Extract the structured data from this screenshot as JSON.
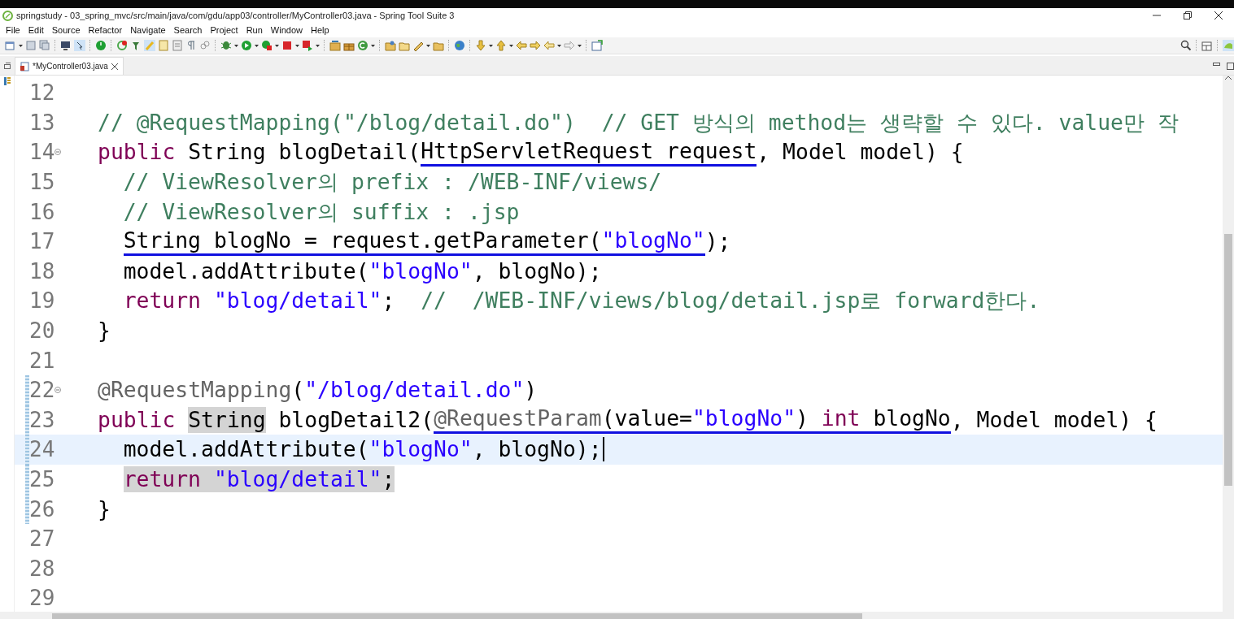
{
  "window": {
    "title": "springstudy - 03_spring_mvc/src/main/java/com/gdu/app03/controller/MyController03.java - Spring Tool Suite 3"
  },
  "menu": [
    "File",
    "Edit",
    "Source",
    "Refactor",
    "Navigate",
    "Search",
    "Project",
    "Run",
    "Window",
    "Help"
  ],
  "tabs": [
    {
      "label": "*MyController03.java",
      "selected": true
    }
  ],
  "editor": {
    "lines": [
      {
        "number": "12"
      },
      {
        "number": "13",
        "tokens": [
          {
            "kind": "comment",
            "text": "// @RequestMapping(\"/blog/detail.do\")  // GET 방식의 method는 생략할 수 있다. value만 작"
          }
        ]
      },
      {
        "number": "14",
        "fold": true,
        "tokens": [
          {
            "kind": "keyword",
            "text": "public"
          },
          {
            "kind": "plain",
            "text": " String blogDetail("
          },
          {
            "kind": "plain",
            "text": "HttpServletRequest request",
            "underline": true
          },
          {
            "kind": "plain",
            "text": ", Model model) {"
          }
        ]
      },
      {
        "number": "15",
        "indented": true,
        "tokens": [
          {
            "kind": "comment",
            "text": "// ViewResolver의 prefix : /WEB-INF/views/"
          }
        ]
      },
      {
        "number": "16",
        "indented": true,
        "tokens": [
          {
            "kind": "comment",
            "text": "// ViewResolver의 suffix : .jsp"
          }
        ]
      },
      {
        "number": "17",
        "indented": true,
        "tokens": [
          {
            "kind": "plain",
            "text": "String blogNo = request.getParameter(",
            "underline": true
          },
          {
            "kind": "string",
            "text": "\"blogNo\"",
            "underline": true
          },
          {
            "kind": "plain",
            "text": ");"
          }
        ]
      },
      {
        "number": "18",
        "indented": true,
        "tokens": [
          {
            "kind": "plain",
            "text": "model.addAttribute("
          },
          {
            "kind": "string",
            "text": "\"blogNo\""
          },
          {
            "kind": "plain",
            "text": ", blogNo);"
          }
        ]
      },
      {
        "number": "19",
        "indented": true,
        "tokens": [
          {
            "kind": "keyword",
            "text": "return"
          },
          {
            "kind": "string",
            "text": " \"blog/detail\""
          },
          {
            "kind": "plain",
            "text": ";  "
          },
          {
            "kind": "comment",
            "text": "//  /WEB-INF/views/blog/detail.jsp로 forward한다."
          }
        ]
      },
      {
        "number": "20",
        "tokens": [
          {
            "kind": "plain",
            "text": "}"
          }
        ]
      },
      {
        "number": "21"
      },
      {
        "number": "22",
        "fold": true,
        "changed": true,
        "tokens": [
          {
            "kind": "annotation",
            "text": "@RequestMapping"
          },
          {
            "kind": "plain",
            "text": "("
          },
          {
            "kind": "string",
            "text": "\"/blog/detail.do\""
          },
          {
            "kind": "plain",
            "text": ")"
          }
        ]
      },
      {
        "number": "23",
        "changed": true,
        "tokens": [
          {
            "kind": "keyword",
            "text": "public "
          },
          {
            "kind": "plain",
            "text": "String",
            "highlight": true
          },
          {
            "kind": "plain",
            "text": " blogDetail2("
          },
          {
            "kind": "annotation",
            "text": "@RequestParam",
            "underline": true
          },
          {
            "kind": "plain",
            "text": "(value=",
            "underline": true
          },
          {
            "kind": "string",
            "text": "\"blogNo\"",
            "underline": true
          },
          {
            "kind": "plain",
            "text": ") ",
            "underline": true
          },
          {
            "kind": "keyword",
            "text": "int",
            "underline": true
          },
          {
            "kind": "plain",
            "text": " blogNo",
            "underline": true
          },
          {
            "kind": "plain",
            "text": ", Model model) {"
          }
        ]
      },
      {
        "number": "24",
        "indented": true,
        "changed": true,
        "current": true,
        "tokens": [
          {
            "kind": "plain",
            "text": "model.addAttribute("
          },
          {
            "kind": "string",
            "text": "\"blogNo\""
          },
          {
            "kind": "plain",
            "text": ", blogNo);"
          }
        ]
      },
      {
        "number": "25",
        "indented": true,
        "changed": true,
        "tokens": [
          {
            "kind": "keyword",
            "text": "return ",
            "highlight": true
          },
          {
            "kind": "string",
            "text": "\"blog/detail\"",
            "highlight": true
          },
          {
            "kind": "plain",
            "text": ";",
            "highlight": true
          }
        ]
      },
      {
        "number": "26",
        "changed": true,
        "tokens": [
          {
            "kind": "plain",
            "text": "}"
          }
        ]
      },
      {
        "number": "27"
      },
      {
        "number": "28"
      },
      {
        "number": "29"
      }
    ]
  }
}
